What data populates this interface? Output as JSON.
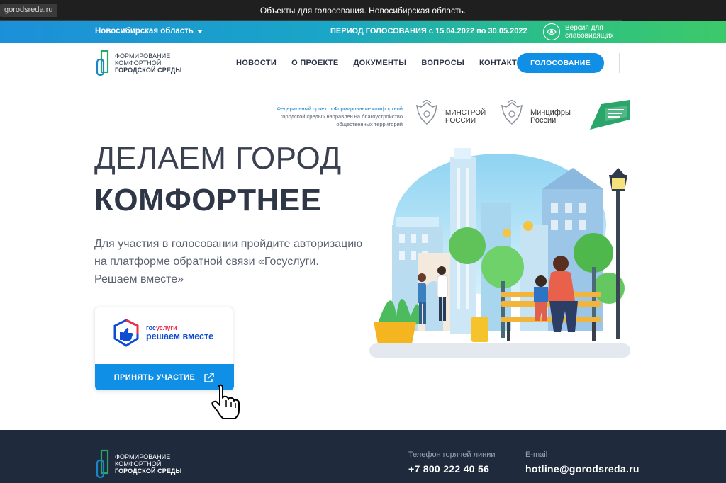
{
  "browser": {
    "url": "gorodsreda.ru",
    "title": "Объекты для голосования. Новосибирская область."
  },
  "topbar": {
    "region": "Новосибирская область",
    "period_label": "ПЕРИОД ГОЛОСОВАНИЯ",
    "period_dates": "с 15.04.2022 по 30.05.2022",
    "accessibility_line1": "Версия для",
    "accessibility_line2": "слабовидящих"
  },
  "logo": {
    "line1": "Формирование",
    "line2": "комфортной",
    "line3": "городской среды"
  },
  "nav": {
    "items": [
      "НОВОСТИ",
      "О ПРОЕКТЕ",
      "ДОКУМЕНТЫ",
      "ВОПРОСЫ",
      "КОНТАКТЫ"
    ],
    "vote_button": "ГОЛОСОВАНИЕ"
  },
  "partners": {
    "federal_line1": "Федеральный проект «Формирование комфортной",
    "federal_line2": "городской среды» направлен на благоустройство",
    "federal_line3": "общественных территорий",
    "minstroy_line1": "МИНСТРОЙ",
    "minstroy_line2": "РОССИИ",
    "mincifry_line1": "Минцифры",
    "mincifry_line2": "России"
  },
  "hero": {
    "title_line1": "ДЕЛАЕМ ГОРОД",
    "title_line2": "КОМФОРТНЕЕ",
    "description": "Для участия в голосовании пройдите авторизацию на платформе обратной связи «Госуслуги. Решаем вместе»"
  },
  "card": {
    "gos_prefix": "гос",
    "gos_suffix": "услуги",
    "brand_line": "решаем вместе",
    "button": "ПРИНЯТЬ УЧАСТИЕ"
  },
  "footer": {
    "phone_label": "Телефон горячей линии",
    "phone": "+7 800 222 40 56",
    "email_label": "E-mail",
    "email": "hotline@gorodsreda.ru"
  },
  "colors": {
    "accent_blue": "#0f8fe6",
    "footer_bg": "#1f2b3d",
    "gradient_start": "#1c8fd9",
    "gradient_end": "#3dc96a"
  }
}
